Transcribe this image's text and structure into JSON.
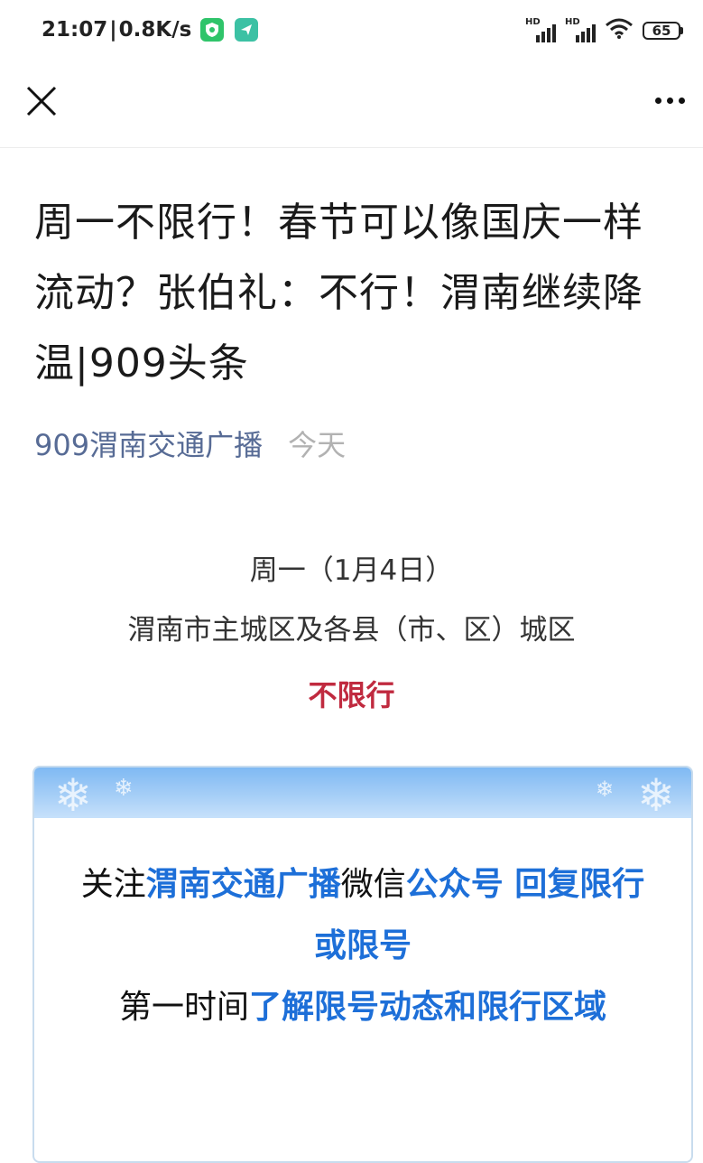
{
  "status_bar": {
    "time": "21:07",
    "separator": "|",
    "net_speed": "0.8K/s",
    "hd_label": "HD",
    "battery": "65"
  },
  "nav": {
    "close_icon": "close-icon",
    "more_icon": "more-icon"
  },
  "article": {
    "title": "周一不限行！春节可以像国庆一样流动？张伯礼：不行！渭南继续降温|909头条",
    "account": "909渭南交通广播",
    "date": "今天",
    "line1": "周一（1月4日）",
    "line2": "渭南市主城区及各县（市、区）城区",
    "line3": "不限行"
  },
  "card": {
    "p1_a": "关注",
    "p1_b": "渭南交通广播",
    "p1_c": "微信",
    "p1_d": "公众号 回复限行或限号",
    "p2_a": "第一时间",
    "p2_b": "了解限号动态和限行区域"
  },
  "colors": {
    "account_link": "#576b95",
    "no_restriction": "#c02a3f",
    "card_highlight": "#1d6fd8"
  }
}
